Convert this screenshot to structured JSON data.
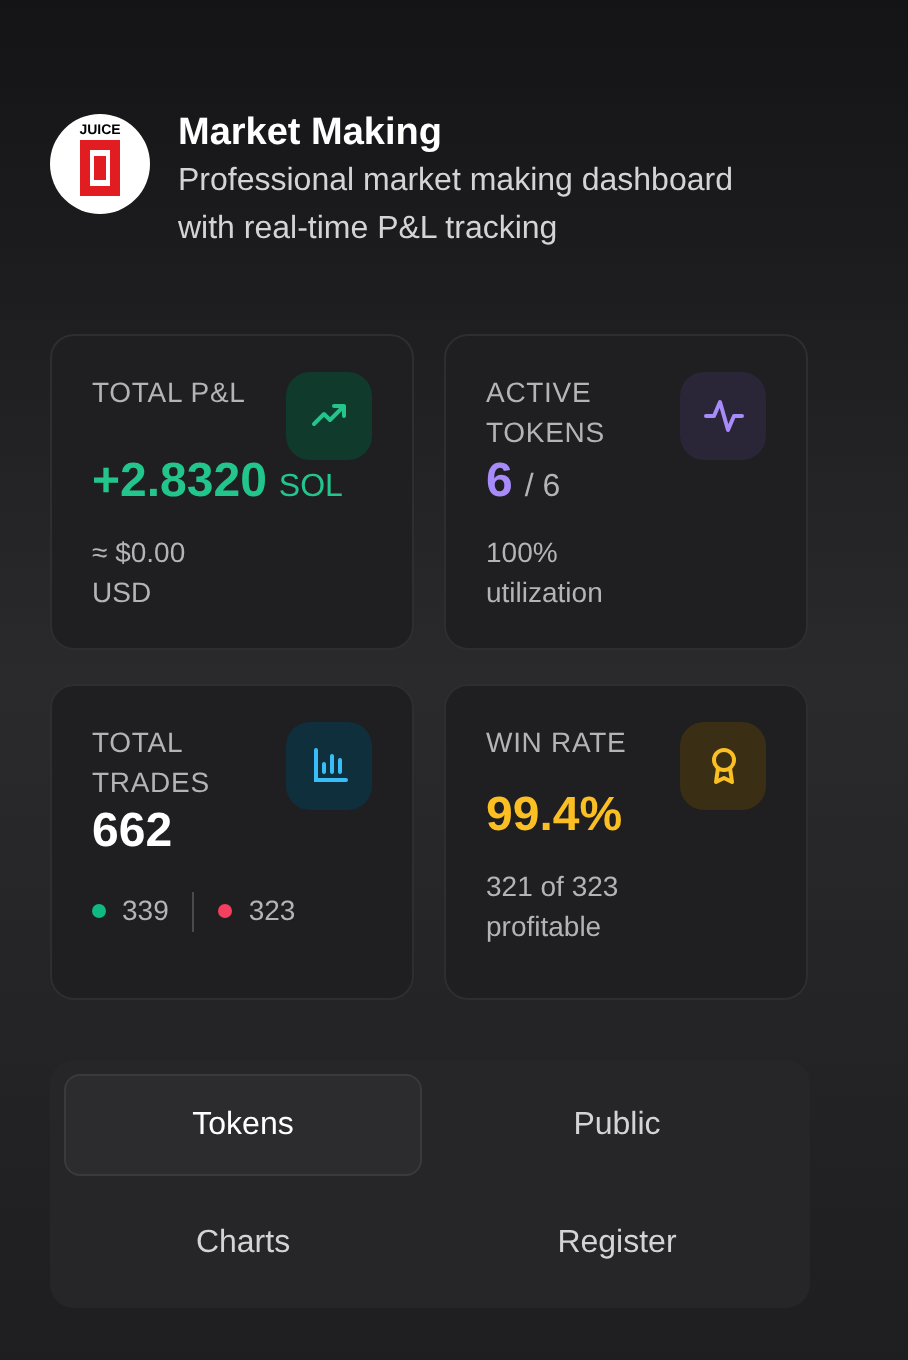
{
  "header": {
    "logo_text": "JUICE",
    "title": "Market Making",
    "subtitle": "Professional market making dashboard with real-time P&L tracking"
  },
  "stats": [
    {
      "kind": "pnl",
      "label": "TOTAL P&L",
      "value": "+2.8320",
      "unit": "SOL",
      "notes": [
        "≈ $0.00",
        "USD"
      ],
      "color": "#22c58b"
    },
    {
      "kind": "tokens",
      "label": "ACTIVE TOKENS",
      "value": "6",
      "unit": "/ 6",
      "notes": [
        "100%",
        "utilization"
      ],
      "color": "#a78bfa"
    },
    {
      "kind": "trades",
      "label": "TOTAL TRADES",
      "value": "662",
      "counts": [
        {
          "text": "339",
          "color": "#10b981"
        },
        {
          "text": "323",
          "color": "#f43f5e"
        }
      ],
      "color": "#ffffff"
    },
    {
      "kind": "winrate",
      "label": "WIN RATE",
      "value": "99.4%",
      "notes": [
        "321 of 323",
        "profitable"
      ],
      "color": "#fbbf24"
    }
  ],
  "tabs": [
    {
      "label": "Tokens",
      "selected": true
    },
    {
      "label": "Public",
      "selected": false
    },
    {
      "label": "Charts",
      "selected": false
    },
    {
      "label": "Register",
      "selected": false
    }
  ]
}
